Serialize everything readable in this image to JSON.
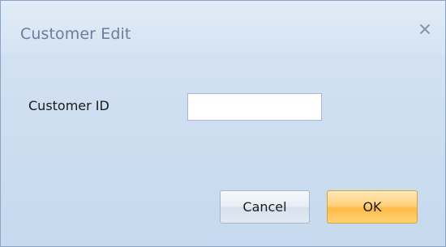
{
  "window": {
    "title": "Customer Edit",
    "close_icon": "close-icon"
  },
  "form": {
    "customer_id_label": "Customer ID",
    "customer_id_value": ""
  },
  "buttons": {
    "cancel_label": "Cancel",
    "ok_label": "OK"
  },
  "colors": {
    "dialog_background": "#cfdff1",
    "title_text": "#6a7d96",
    "ok_button": "#ffd27e",
    "cancel_button": "#e6edf5"
  }
}
